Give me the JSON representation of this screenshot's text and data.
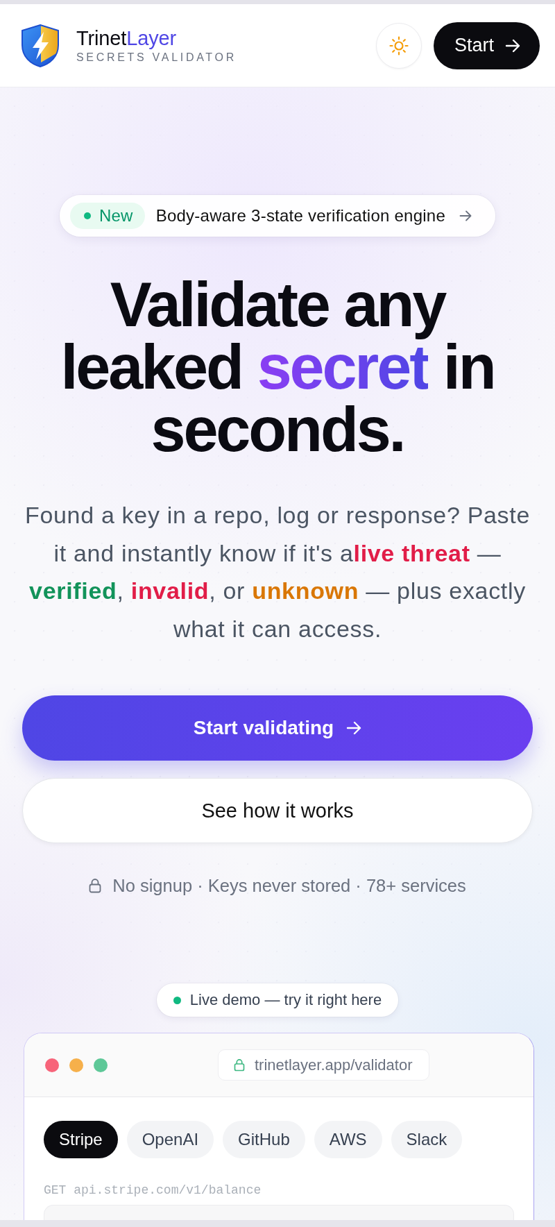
{
  "header": {
    "brand_name": [
      {
        "text": "Trinet",
        "kind": "plain"
      },
      {
        "text": "Layer",
        "kind": "accent"
      }
    ],
    "tagline": "SECRETS VALIDATOR",
    "start_button": "Start"
  },
  "announcement": {
    "tag": "New",
    "text": "Body-aware 3-state verification engine"
  },
  "hero": {
    "title": [
      {
        "text": "Validate any leaked ",
        "kind": "plain"
      },
      {
        "text": "secret",
        "kind": "accent"
      },
      {
        "text": " in seconds.",
        "kind": "plain"
      }
    ],
    "description": [
      {
        "text": "Found a key in a repo, log or response? Paste it and instantly know if it's a",
        "kind": "plain"
      },
      {
        "text": "live threat",
        "kind": "threat"
      },
      {
        "text": " — ",
        "kind": "plain"
      },
      {
        "text": "verified",
        "kind": "verified"
      },
      {
        "text": ", ",
        "kind": "plain"
      },
      {
        "text": "invalid",
        "kind": "invalid"
      },
      {
        "text": ", or ",
        "kind": "plain"
      },
      {
        "text": "unknown",
        "kind": "unknown"
      },
      {
        "text": " — plus exactly what it can access.",
        "kind": "plain"
      }
    ],
    "primary_button": "Start validating",
    "secondary_button": "See how it works",
    "trust_note": "No signup · Keys never stored · 78+ services"
  },
  "demo": {
    "label": "Live demo — try it right here",
    "url": "trinetlayer.app/validator",
    "tabs": [
      {
        "label": "Stripe",
        "selected": true
      },
      {
        "label": "OpenAI",
        "selected": false
      },
      {
        "label": "GitHub",
        "selected": false
      },
      {
        "label": "AWS",
        "selected": false
      },
      {
        "label": "Slack",
        "selected": false
      }
    ],
    "endpoint": "GET api.stripe.com/v1/balance"
  }
}
